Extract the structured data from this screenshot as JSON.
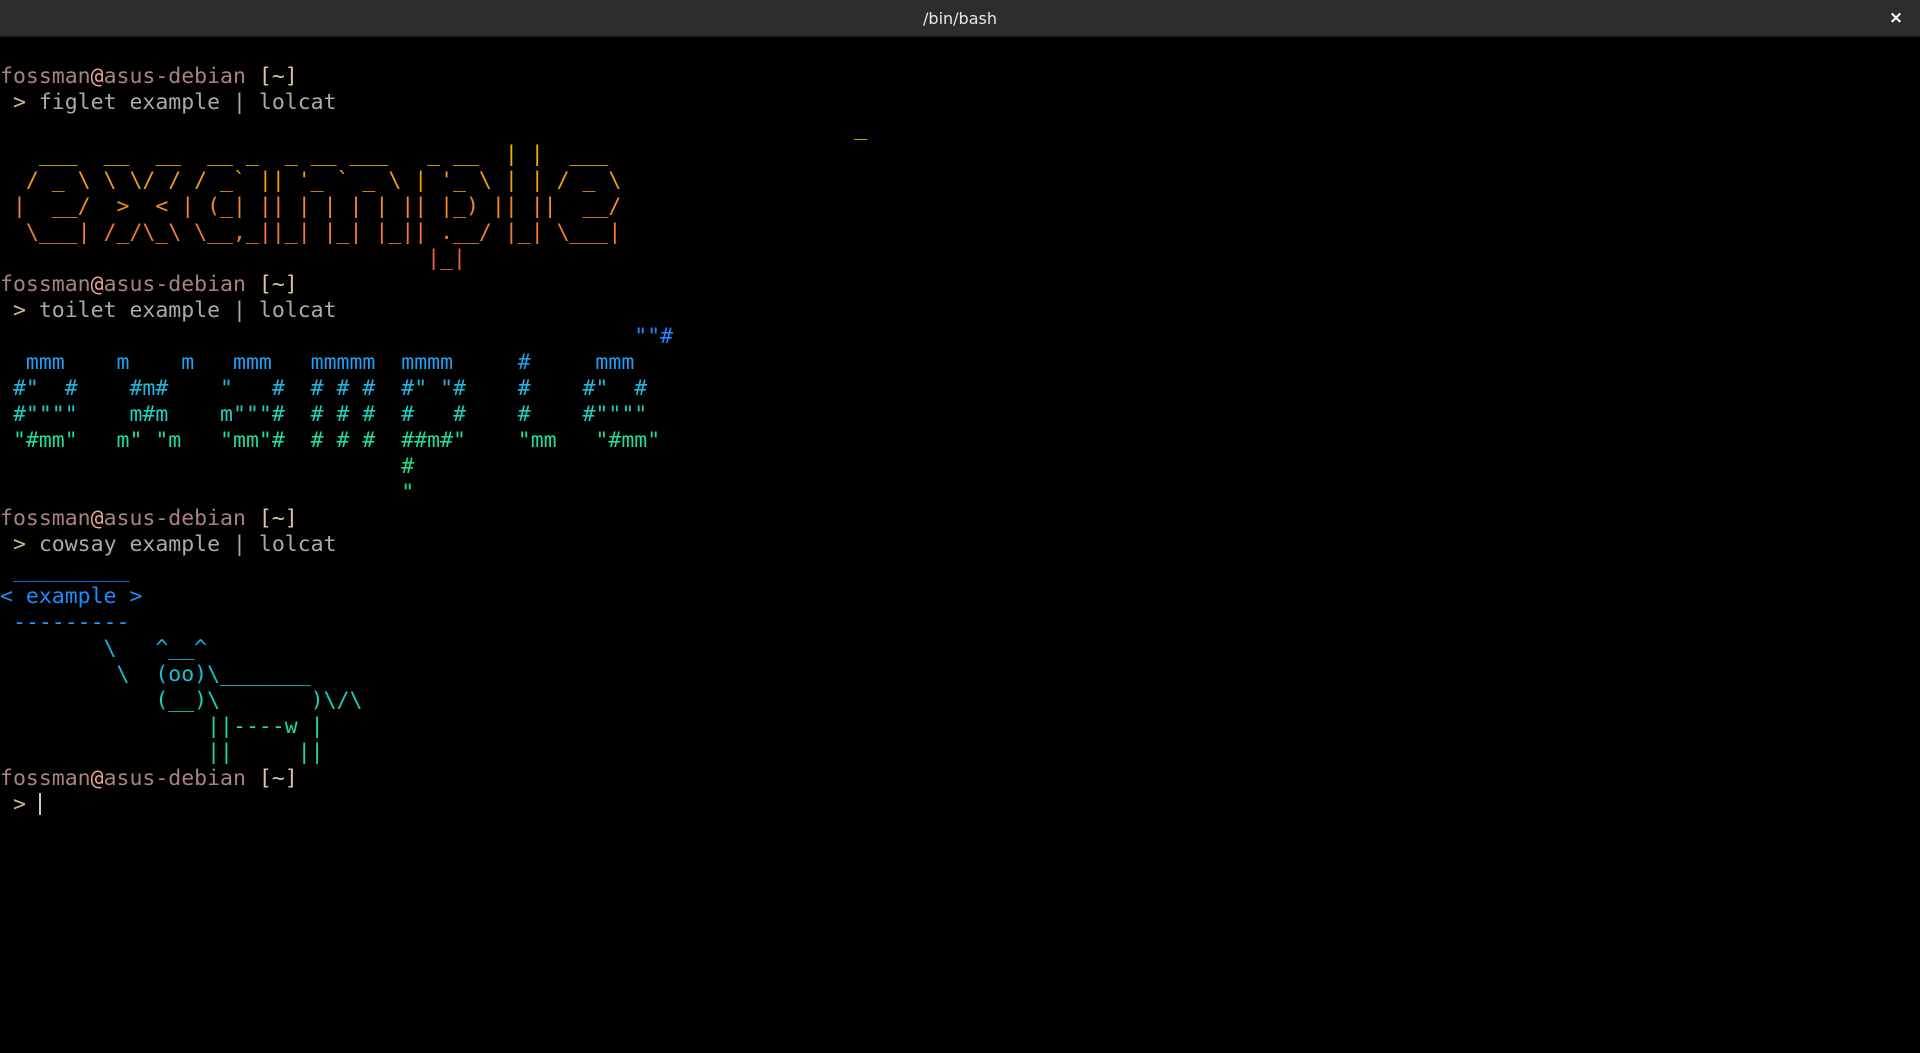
{
  "window": {
    "title": "/bin/bash",
    "close_label": "×"
  },
  "prompt": {
    "user": "fossman",
    "at": "@",
    "host": "asus-debian",
    "cwd": " [~]",
    "arrow": " > "
  },
  "blocks": [
    {
      "command": "figlet example | lolcat",
      "output": [
        "                                                                  _      ",
        "   ___  __  __  __ _  _ __ ___   _ __  | |  ___ ",
        "  / _ \\ \\ \\/ / / _` || '_ ` _ \\ | '_ \\ | | / _ \\",
        " |  __/  >  < | (_| || | | | | || |_) || ||  __/",
        "  \\___| /_/\\_\\ \\__,_||_| |_| |_|| .__/ |_| \\___|",
        "                                 |_|              "
      ]
    },
    {
      "command": "toilet example | lolcat",
      "output": [
        "                                                 \"\"#",
        "  mmm    m    m   mmm   mmmmm  mmmm     #     mmm",
        " #\"  #    #m#    \"   #  # # #  #\" \"#    #    #\"  #",
        " #\"\"\"\"    m#m    m\"\"\"#  # # #  #   #    #    #\"\"\"\"",
        " \"#mm\"   m\" \"m   \"mm\"#  # # #  ##m#\"    \"mm   \"#mm\"",
        "                               #",
        "                               \""
      ]
    },
    {
      "command": "cowsay example | lolcat",
      "output": [
        " _________",
        "< example >",
        " ---------",
        "        \\   ^__^",
        "         \\  (oo)\\_______",
        "            (__)\\       )\\/\\",
        "                ||----w |",
        "                ||     ||"
      ]
    }
  ],
  "colors": {
    "figlet": [
      "#f0c000",
      "#f0b000",
      "#f59a14",
      "#f58a24",
      "#f27a30",
      "#ee5f4a"
    ],
    "toilet": [
      "#1e88ff",
      "#1ea0f0",
      "#1eb8e0",
      "#1ecfc0",
      "#1edc9a",
      "#20e07a"
    ],
    "cowsay": [
      "#1b7fff",
      "#1b8dff",
      "#1b9cff",
      "#1ab0e0",
      "#19c0d0",
      "#18cfc0",
      "#17dca8",
      "#16e090"
    ]
  }
}
